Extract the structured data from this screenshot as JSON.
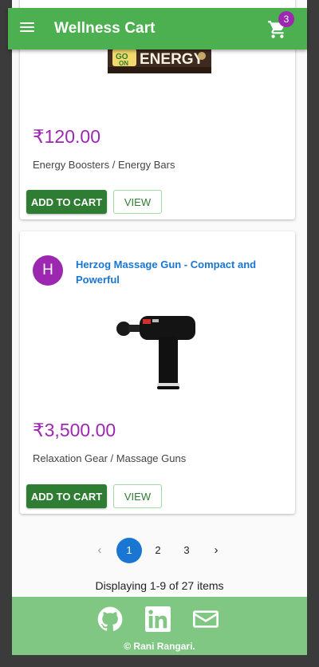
{
  "app": {
    "title": "Wellness Cart",
    "cart_count": "3"
  },
  "products": [
    {
      "logo_text": "ENERGY",
      "price": "₹120.00",
      "category": "Energy Boosters / Energy Bars",
      "add_label": "ADD TO CART",
      "view_label": "VIEW"
    },
    {
      "avatar_letter": "H",
      "title": "Herzog Massage Gun - Compact and Powerful",
      "price": "₹3,500.00",
      "category": "Relaxation Gear / Massage Guns",
      "add_label": "ADD TO CART",
      "view_label": "VIEW"
    }
  ],
  "pagination": {
    "prev_icon": "chevron-left-icon",
    "pages": [
      "1",
      "2",
      "3"
    ],
    "current": "1",
    "next_icon": "chevron-right-icon"
  },
  "status_text": "Displaying 1-9 of 27 items",
  "footer": {
    "icons": [
      "github-icon",
      "linkedin-icon",
      "mail-icon"
    ],
    "copyright": "© Rani Rangari."
  },
  "colors": {
    "appbar": "#4caf50",
    "accent_purple": "#9c27b0",
    "button_green": "#2e7d32",
    "link_blue": "#1976d2",
    "footer": "#81c784"
  }
}
